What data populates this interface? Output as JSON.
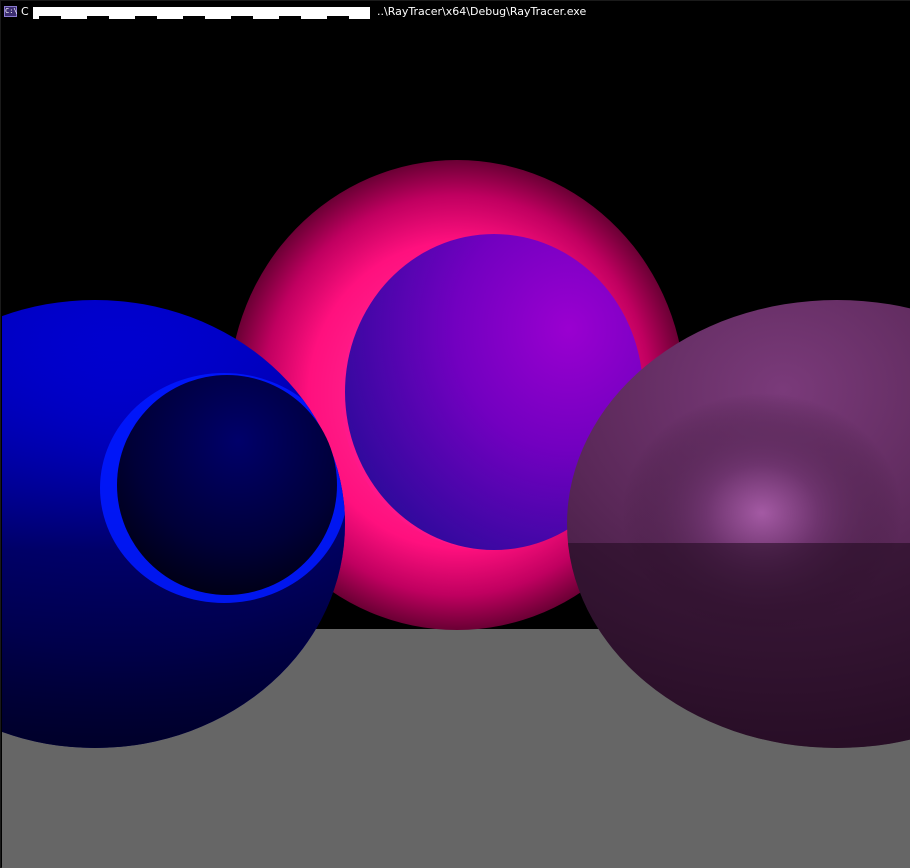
{
  "window": {
    "title_start": "C",
    "title_end": "..\\RayTracer\\x64\\Debug\\RayTracer.exe",
    "icon": "console-icon",
    "icon_text": "C:\\"
  },
  "scene": {
    "background_color": "#000000",
    "floor_color": "#666666",
    "spheres": [
      {
        "name": "left-sphere",
        "color": "#0000ff"
      },
      {
        "name": "center-sphere",
        "color": "#ff0080"
      },
      {
        "name": "inner-sphere",
        "color": "#8a00c8"
      },
      {
        "name": "right-sphere",
        "color": "#6a2d6a"
      }
    ]
  }
}
